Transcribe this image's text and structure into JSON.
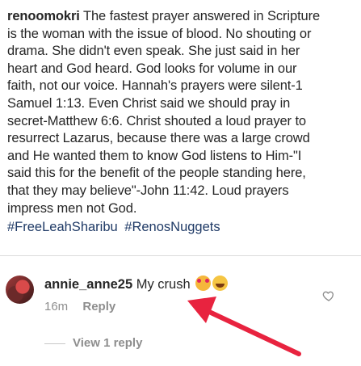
{
  "post": {
    "username": "renoomokri",
    "caption_lines": [
      " The fastest prayer answered in Scripture",
      "is the woman with the issue of blood. No shouting or",
      "drama. She didn't even speak. She just said in her",
      "heart and God heard. God looks for volume in our",
      "faith, not our voice. Hannah's prayers were silent-1",
      "Samuel 1:13. Even Christ said we should pray in",
      "secret-Matthew 6:6. Christ shouted a loud prayer to",
      "resurrect Lazarus, because there was a large crowd",
      "and He wanted them to know God listens to Him-\"I",
      "said this for the benefit of the people standing here,",
      "that they may believe\"-John 11:42. Loud prayers",
      "impress men not God."
    ],
    "hashtags": [
      "#FreeLeahSharibu",
      "#RenosNuggets"
    ]
  },
  "comment": {
    "username": "annie_anne25",
    "text": " My crush",
    "emojis": [
      "smiling-face-with-hearts-emoji",
      "tears-of-joy-emoji"
    ],
    "time": "16m",
    "reply_label": "Reply",
    "view_replies": "View 1 reply"
  },
  "colors": {
    "text": "#262626",
    "hashtag": "#1f3a66",
    "meta": "#8e8e8e",
    "annotation_arrow": "#e8233f"
  }
}
